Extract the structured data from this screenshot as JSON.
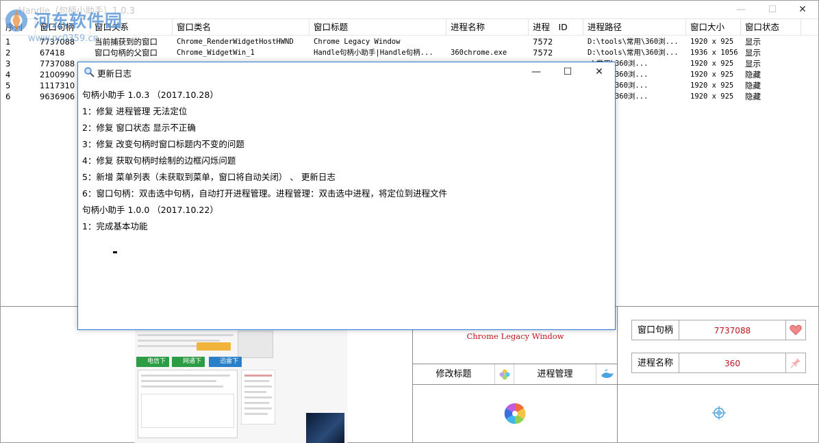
{
  "app": {
    "title": "Handle（句柄小助手）1.0.3",
    "watermark_text": "河东软件园",
    "watermark_url": "www.pc0359.cn"
  },
  "window_controls": {
    "minimize": "—",
    "maximize": "☐",
    "close": "✕"
  },
  "table": {
    "columns": [
      "序列",
      "窗口句柄",
      "窗口关系",
      "窗口类名",
      "窗口标题",
      "进程名称",
      "进程　ID",
      "进程路径",
      "窗口大小",
      "窗口状态"
    ],
    "rows": [
      {
        "seq": "1",
        "handle": "7737088",
        "relation": "当前捕获到的窗口",
        "class": "Chrome_RenderWidgetHostHWND",
        "title": "Chrome Legacy Window",
        "process": "",
        "pid": "7572",
        "path": "D:\\tools\\常用\\360浏...",
        "size": "1920 x 925",
        "state": "显示"
      },
      {
        "seq": "2",
        "handle": "67418",
        "relation": "窗口句柄的父窗口",
        "class": "Chrome_WidgetWin_1",
        "title": "Handle句柄小助手|Handle句柄...",
        "process": "360chrome.exe",
        "pid": "7572",
        "path": "D:\\tools\\常用\\360浏...",
        "size": "1936 x 1056",
        "state": "显示"
      },
      {
        "seq": "3",
        "handle": "7737088",
        "relation": "",
        "class": "",
        "title": "",
        "process": "",
        "pid": "",
        "path": "s\\常用\\360浏...",
        "size": "1920 x 925",
        "state": "显示"
      },
      {
        "seq": "4",
        "handle": "2100990",
        "relation": "",
        "class": "",
        "title": "",
        "process": "",
        "pid": "",
        "path": "s\\常用\\360浏...",
        "size": "1920 x 925",
        "state": "隐藏"
      },
      {
        "seq": "5",
        "handle": "1117310",
        "relation": "",
        "class": "",
        "title": "",
        "process": "",
        "pid": "",
        "path": "s\\常用\\360浏...",
        "size": "1920 x 925",
        "state": "隐藏"
      },
      {
        "seq": "6",
        "handle": "9636906",
        "relation": "",
        "class": "",
        "title": "",
        "process": "",
        "pid": "",
        "path": "s\\常用\\360浏...",
        "size": "1920 x 925",
        "state": "隐藏"
      }
    ]
  },
  "preview": {
    "btn_telecom": "电信下载",
    "btn_netcom": "网通下载",
    "btn_thunder": "迅雷下载"
  },
  "bottom": {
    "window_title_value": "Chrome Legacy Window",
    "modify_title_btn": "修改标题",
    "process_manage_btn": "进程管理",
    "handle_label": "窗口句柄",
    "handle_value": "7737088",
    "process_label": "进程名称",
    "process_value": "360"
  },
  "dialog": {
    "title": "更新日志",
    "lines": [
      "句柄小助手 1.0.3 （2017.10.28）",
      "1：修复 进程管理 无法定位",
      "2：修复 窗口状态 显示不正确",
      "3：修复 改变句柄时窗口标题内不变的问题",
      "4：修复 获取句柄时绘制的边框闪烁问题",
      "5：新增 菜单列表（未获取到菜单，窗口将自动关闭） 、 更新日志",
      "6：窗口句柄：双击选中句柄，自动打开进程管理。进程管理：双击选中进程，将定位到进程文件",
      "句柄小助手 1.0.0 （2017.10.22）",
      "1：完成基本功能"
    ]
  },
  "colors": {
    "accent_red": "#c0141e",
    "dialog_border": "#2b79d8",
    "watermark": "#5d98d8"
  }
}
